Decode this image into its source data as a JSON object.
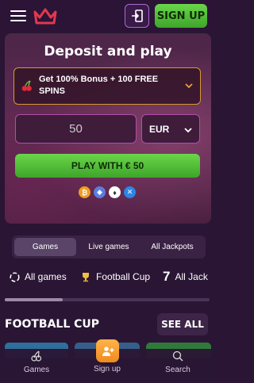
{
  "header": {
    "signup_label": "SIGN UP"
  },
  "hero": {
    "title": "Deposit and play",
    "bonus_text": "Get 100% Bonus + 100 FREE SPINS",
    "amount_value": "50",
    "currency": "EUR",
    "play_label": "PLAY WITH € 50",
    "crypto_icons": [
      "bitcoin-icon",
      "tether-icon",
      "ethereum-icon",
      "ripple-icon"
    ]
  },
  "tabs": [
    {
      "label": "Games",
      "active": true
    },
    {
      "label": "Live games",
      "active": false
    },
    {
      "label": "All Jackpots",
      "active": false
    }
  ],
  "categories": [
    {
      "label": "All games",
      "icon": "all-games-icon"
    },
    {
      "label": "Football Cup",
      "icon": "trophy-icon"
    },
    {
      "label": "All Jack",
      "icon": "seven-icon"
    }
  ],
  "section": {
    "title": "FOOTBALL CUP",
    "see_all_label": "SEE ALL"
  },
  "bottom_nav": [
    {
      "label": "Games",
      "icon": "cherries-icon"
    },
    {
      "label": "Sign up",
      "icon": "user-plus-icon"
    },
    {
      "label": "Search",
      "icon": "search-icon"
    }
  ],
  "colors": {
    "accent_green": "#4cba32",
    "accent_orange": "#f39a2a",
    "bonus_border": "#d59a2e",
    "input_border": "#b24dad",
    "background": "#2a1534"
  }
}
